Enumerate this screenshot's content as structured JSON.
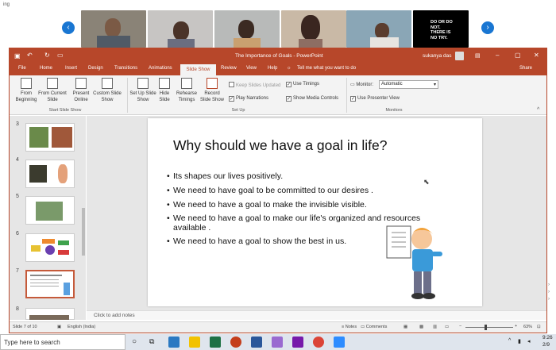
{
  "meeting": {
    "title": "ing",
    "stamp_text": "DO OR DO NOT. THERE IS NO TRY."
  },
  "window": {
    "title": "The Importance of Goals - PowerPoint",
    "user": "sukanya das"
  },
  "tabs": [
    "File",
    "Home",
    "Insert",
    "Design",
    "Transitions",
    "Animations",
    "Slide Show",
    "Review",
    "View",
    "Help"
  ],
  "active_tab": "Slide Show",
  "tell_me": "Tell me what you want to do",
  "share": "Share",
  "ribbon": {
    "start_group": {
      "label": "Start Slide Show",
      "buttons": [
        "From Beginning",
        "From Current Slide",
        "Present Online",
        "Custom Slide Show"
      ]
    },
    "setup_group": {
      "label": "Set Up",
      "buttons": [
        "Set Up Slide Show",
        "Hide Slide",
        "Rehearse Timings",
        "Record Slide Show"
      ]
    },
    "checks": [
      {
        "label": "Keep Slides Updated",
        "checked": false,
        "disabled": true
      },
      {
        "label": "Play Narrations",
        "checked": true
      },
      {
        "label": "Use Timings",
        "checked": true
      },
      {
        "label": "Show Media Controls",
        "checked": true
      },
      {
        "label": "Use Presenter View",
        "checked": true
      }
    ],
    "monitors_group": {
      "label": "Monitors",
      "monitor_label": "Monitor:",
      "monitor_value": "Automatic"
    }
  },
  "slides": [
    "3",
    "4",
    "5",
    "6",
    "7",
    "8"
  ],
  "slide": {
    "title": "Why should we have a goal in life?",
    "bullets": [
      "Its shapes our lives positively.",
      "We need to have goal to be committed to our desires .",
      "We need to have a goal to make the invisible visible.",
      "We need to have a goal to make our life's organized and resources available .",
      "We need to have a goal to show the best in us."
    ]
  },
  "notes_placeholder": "Click to add notes",
  "status": {
    "slide": "Slide 7 of 10",
    "language": "English (India)",
    "notes": "Notes",
    "comments": "Comments",
    "zoom": "63%"
  },
  "taskbar": {
    "search_placeholder": "Type here to search",
    "time": "9:26",
    "date": "2/9"
  },
  "colors": {
    "ppt_accent": "#b7472a",
    "nav_blue": "#1976d2"
  }
}
